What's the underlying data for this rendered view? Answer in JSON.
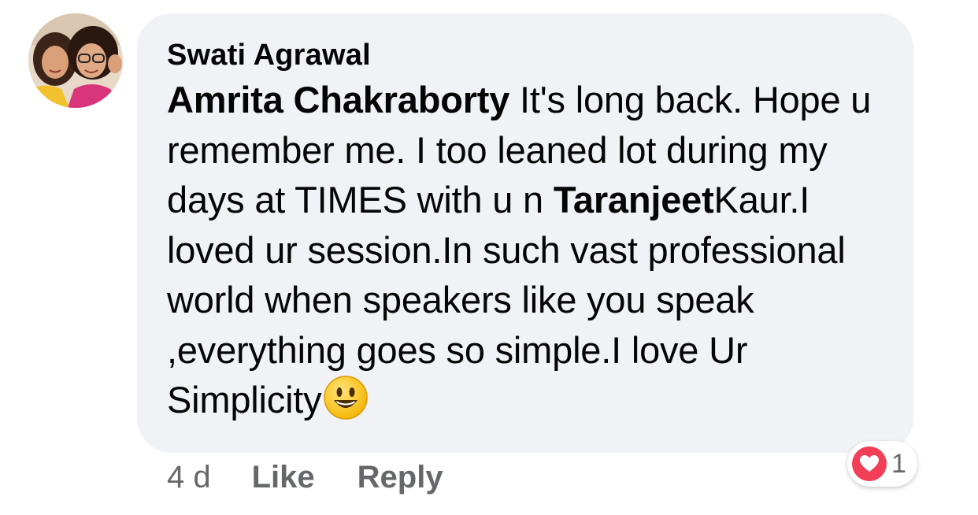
{
  "comment": {
    "author": "Swati Agrawal",
    "mentions": {
      "first": "Amrita Chakraborty",
      "second": "Taranjeet"
    },
    "text": {
      "part1": " It's long back. Hope u remember me. I too leaned lot during my days at TIMES with u n ",
      "part2": "Kaur.I loved ur session.In such vast professional world when speakers like you speak ,everything goes so simple.I love Ur Simplicity"
    },
    "emoji": "smiley-emoji"
  },
  "reaction": {
    "icon": "heart-icon",
    "count": "1",
    "color": "#f33e58"
  },
  "actions": {
    "time": "4 d",
    "like": "Like",
    "reply": "Reply"
  },
  "colors": {
    "bubble": "#f0f2f5",
    "secondary_text": "#65676b"
  }
}
